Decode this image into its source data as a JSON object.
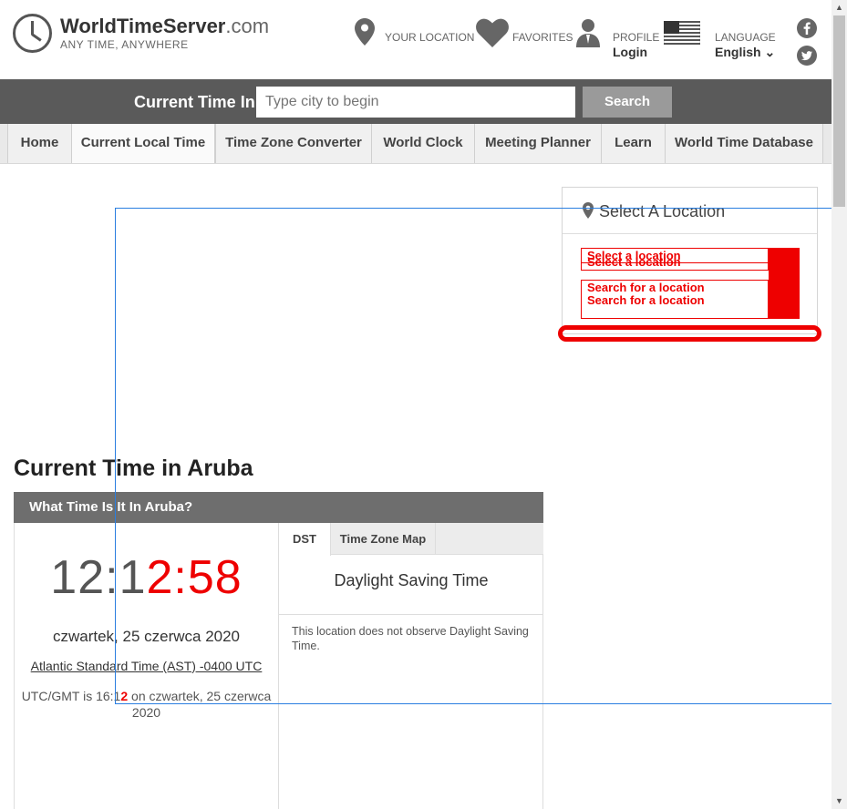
{
  "header": {
    "logo_title_bold": "WorldTimeServer",
    "logo_title_domain": ".com",
    "logo_tagline": "ANY TIME, ANYWHERE",
    "your_location_label": "YOUR LOCATION",
    "favorites_label": "FAVORITES",
    "profile_label": "PROFILE",
    "profile_value": "Login",
    "language_label": "LANGUAGE",
    "language_value": "English ⌄"
  },
  "search": {
    "label": "Current Time In",
    "placeholder": "Type city to begin",
    "button": "Search"
  },
  "tabs": [
    "Home",
    "Current Local Time",
    "Time Zone Converter",
    "World Clock",
    "Meeting Planner",
    "Learn",
    "World Time Database"
  ],
  "location_panel": {
    "title": "Select A Location",
    "row1a": "Select a location",
    "row1b": "Select a location",
    "row2a": "Search for a location",
    "row2b": "Search for a location"
  },
  "main": {
    "title": "Current Time in Aruba",
    "card_heading": "What Time Is It In Aruba?",
    "clock_prefix": "12:1",
    "clock_highlight": "2:58",
    "date": "czwartek, 25 czerwca 2020",
    "timezone": "Atlantic Standard Time (AST) -0400 UTC",
    "utc_prefix": "UTC/GMT is 16:1",
    "utc_highlight": "2",
    "utc_suffix": " on czwartek, 25 czerwca 2020"
  },
  "side_tabs": {
    "dst": "DST",
    "map": "Time Zone Map",
    "dst_title": "Daylight Saving Time",
    "dst_text": "This location does not observe Daylight Saving Time."
  },
  "colors": {
    "header_bar": "#5a5a5a",
    "card_heading": "#6e6e6e",
    "annotation_red": "#e00000",
    "annotation_blue": "#2a7ee0"
  }
}
